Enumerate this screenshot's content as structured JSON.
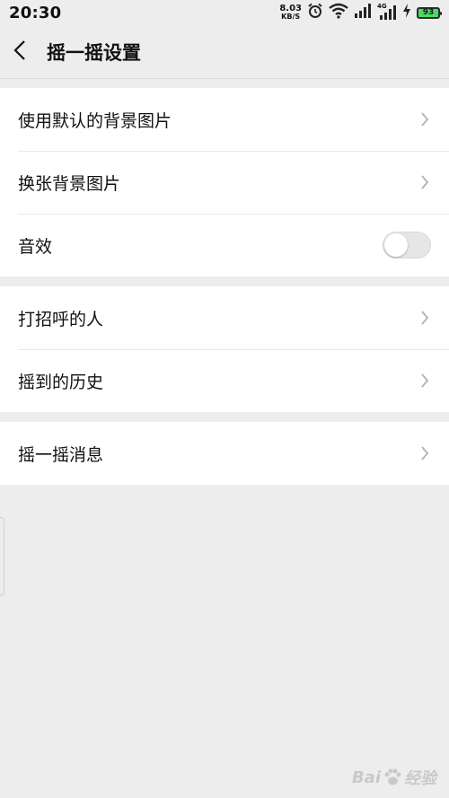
{
  "status_bar": {
    "time": "20:30",
    "net_speed_value": "8.03",
    "net_speed_unit": "KB/S",
    "network_type": "4G",
    "battery_level": "93",
    "battery_color": "#4bd964"
  },
  "header": {
    "back_icon": "chevron-left-icon",
    "title": "摇一摇设置"
  },
  "groups": [
    {
      "items": [
        {
          "label": "使用默认的背景图片",
          "control": "chevron"
        },
        {
          "label": "换张背景图片",
          "control": "chevron"
        },
        {
          "label": "音效",
          "control": "toggle",
          "toggle_on": false
        }
      ]
    },
    {
      "items": [
        {
          "label": "打招呼的人",
          "control": "chevron"
        },
        {
          "label": "摇到的历史",
          "control": "chevron"
        }
      ]
    },
    {
      "items": [
        {
          "label": "摇一摇消息",
          "control": "chevron"
        }
      ]
    }
  ],
  "watermark": {
    "text_left": "Bai",
    "text_right": "经验"
  },
  "colors": {
    "background": "#ededed",
    "card": "#ffffff",
    "chevron": "#b2b2b2",
    "toggle_off": "#e6e6e6"
  }
}
